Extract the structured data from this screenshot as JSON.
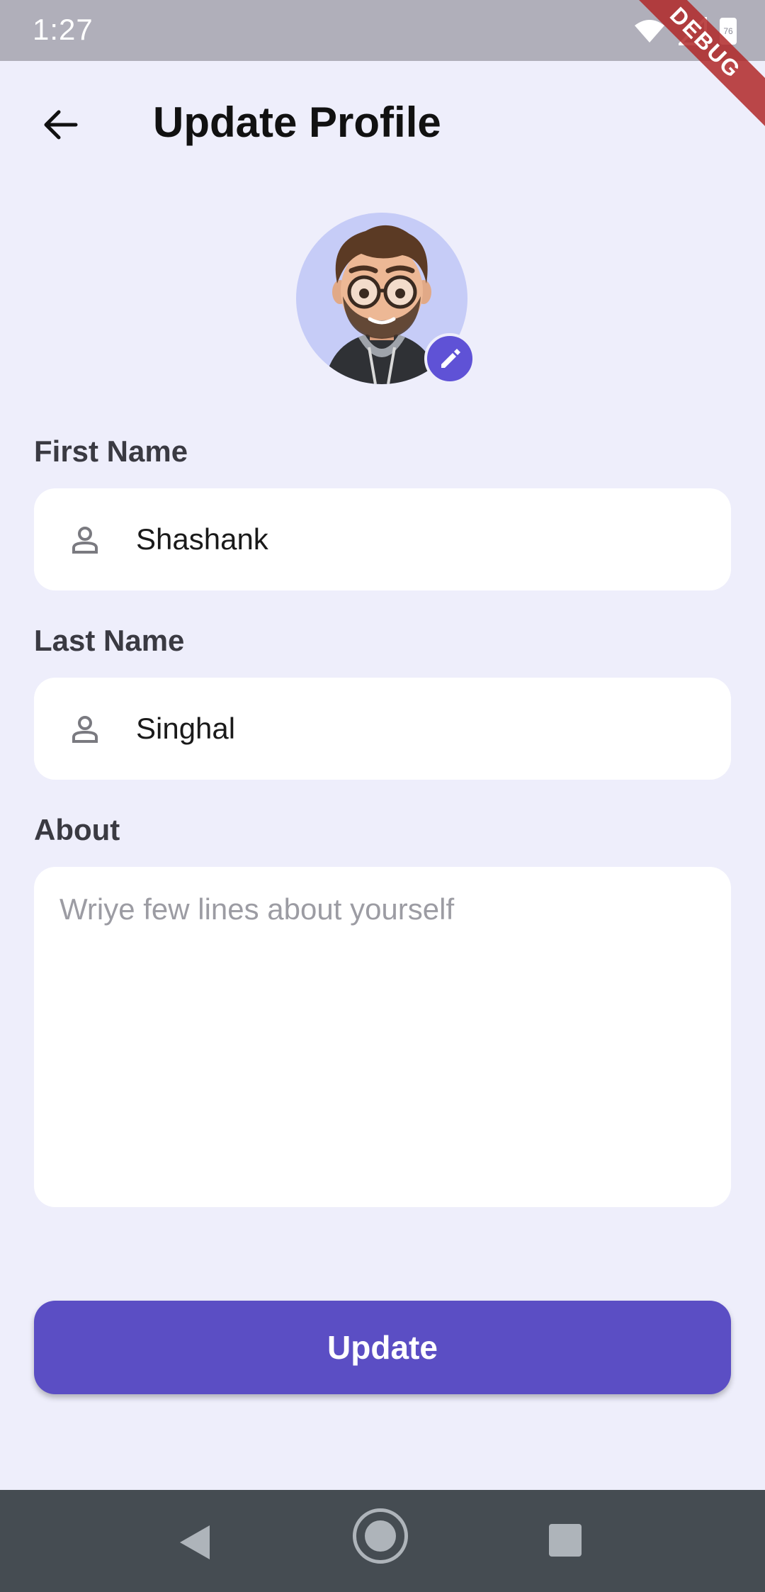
{
  "status_bar": {
    "time": "1:27",
    "battery_level": "76",
    "debug_label": "DEBUG"
  },
  "app_bar": {
    "title": "Update Profile",
    "back_icon": "arrow-left-icon"
  },
  "avatar": {
    "edit_icon": "pencil-icon"
  },
  "form": {
    "first_name": {
      "label": "First Name",
      "value": "Shashank",
      "icon": "person-icon"
    },
    "last_name": {
      "label": "Last Name",
      "value": "Singhal",
      "icon": "person-icon"
    },
    "about": {
      "label": "About",
      "placeholder": "Wriye few lines about yourself",
      "value": ""
    }
  },
  "actions": {
    "update_label": "Update"
  },
  "colors": {
    "background": "#EEEEFB",
    "accent": "#5B4EC4",
    "edit_badge": "#5F52D6",
    "nav_bar": "#454C52"
  }
}
